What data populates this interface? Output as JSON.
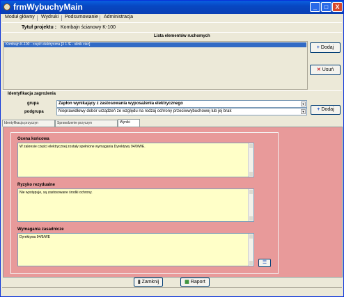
{
  "window": {
    "title": "frmWybuchyMain",
    "minimize": "_",
    "maximize": "□",
    "close": "X"
  },
  "menu": [
    "Moduł główny",
    "Wydruki",
    "Podsumowanie",
    "Administracja"
  ],
  "project": {
    "label": "Tytuł projektu :",
    "value": "Kombajn ścianowy K-100"
  },
  "elements_list": {
    "header": "Lista elementów ruchomych",
    "selected_row": "Kombajn K-100 - część elektryczna [3 1 /E - silnik ciec]"
  },
  "buttons": {
    "add": "Dodaj",
    "remove": "Usuń",
    "add2": "Dodaj",
    "close": "Zamknij",
    "print": "Raport"
  },
  "identification": {
    "header": "Identyfikacja zagrożenia",
    "group_label": "grupa",
    "group_value": "Zapłon wynikający z zastosowania wyposażenia elektrycznego",
    "subgroup_label": "podgrupa",
    "subgroup_value": "Nieprawidłowy dobór urządzeń ze względu na rodzaj ochrony przeciwwybuchowej lub jej brak"
  },
  "tabs": [
    "Identyfikacja przyczyn",
    "Sprawdzenie przyczyn",
    "Wyniki"
  ],
  "wyniki": {
    "final_label": "Ocena końcowa",
    "final_value": "W zakresie części elektrycznej zostały spełnione wymagania Dyrektywy 94/9/WE.",
    "residual_label": "Ryzyko rezydualne",
    "residual_value": "Nie występuje, są zastosowane środki ochrony.",
    "requirements_label": "Wymagania zasadnicze",
    "requirements_value": "Dyrektywa 94/9/WE"
  }
}
